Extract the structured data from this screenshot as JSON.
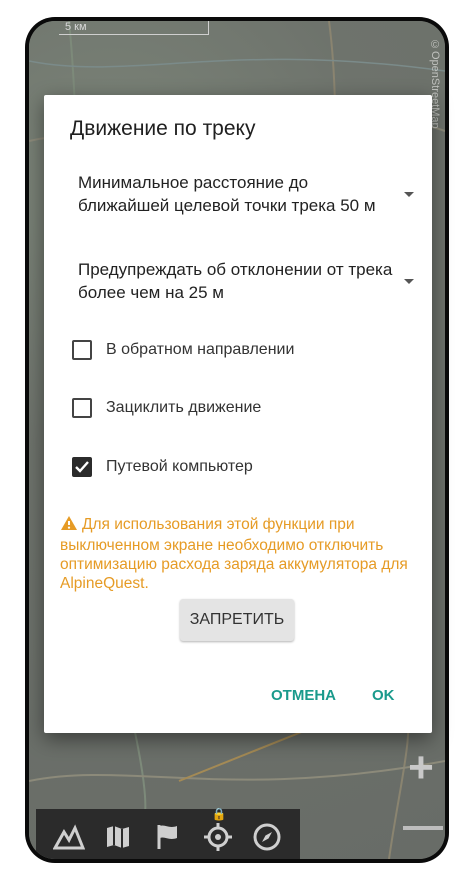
{
  "map": {
    "scale_label": "5 км",
    "credit": "©OpenStreetMap"
  },
  "dialog": {
    "title": "Движение по треку",
    "select_min_distance": "Минимальное расстояние до ближайшей целевой точки трека 50 м",
    "select_deviation": "Предупреждать об отклонении от трека более чем на 25 м",
    "checkbox_reverse": {
      "label": "В обратном направлении",
      "checked": false
    },
    "checkbox_loop": {
      "label": "Зациклить движение",
      "checked": false
    },
    "checkbox_trip_computer": {
      "label": "Путевой компьютер",
      "checked": true
    },
    "warning_text": "Для использования этой функции при выключенном экране необходимо отключить оптимизацию расхода заряда аккумулятора для AlpineQuest.",
    "deny_button": "ЗАПРЕТИТЬ",
    "cancel_button": "ОТМЕНА",
    "ok_button": "OK"
  },
  "toolbar": {
    "icons": [
      "mountain-icon",
      "map-icon",
      "flag-icon",
      "target-icon",
      "compass-icon"
    ]
  },
  "colors": {
    "accent": "#1a9a8c",
    "warning": "#e69b25",
    "toolbar_bg": "#2b2b2b"
  }
}
